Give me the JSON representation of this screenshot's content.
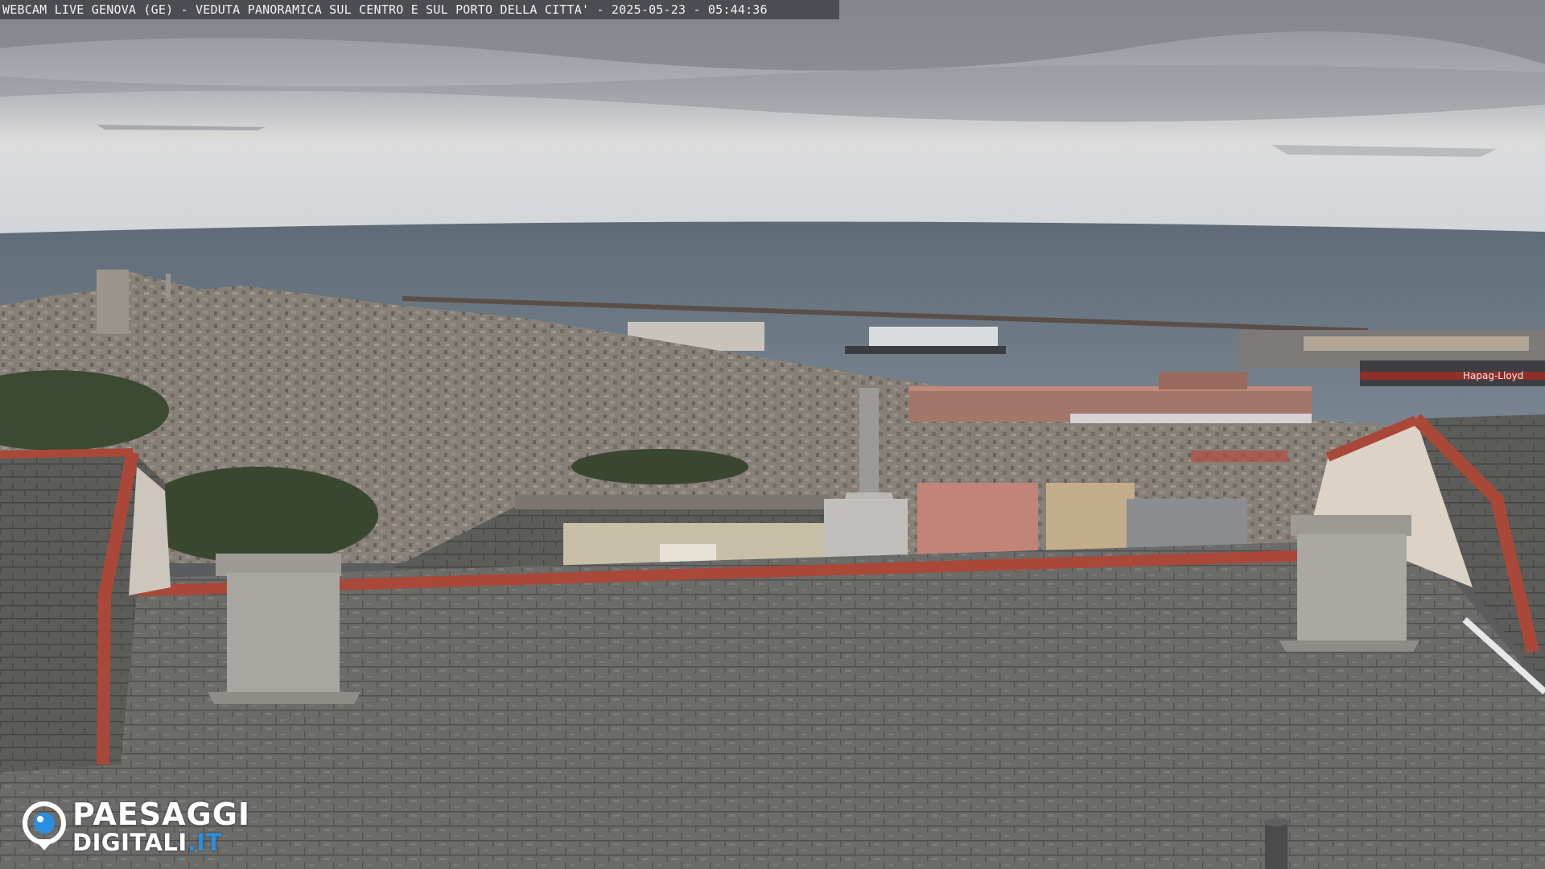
{
  "overlay": {
    "caption": "WEBCAM LIVE GENOVA (GE) - VEDUTA PANORAMICA SUL CENTRO E SUL PORTO DELLA CITTA' - 2025-05-23 - 05:44:36"
  },
  "logo": {
    "line1": "PAESAGGI",
    "line2_main": "DIGITALI",
    "line2_suffix": ".IT",
    "icon": "camera-eye-icon"
  },
  "scene": {
    "ship_name": "Hapag-Lloyd"
  },
  "colors": {
    "caption_background": "#3c3e42",
    "logo_accent": "#2a8fe0",
    "sky": "#c9ccd0",
    "sea": "#6a7580",
    "roof_tiles": "#6c6c6a",
    "roof_edge": "#b0483a"
  }
}
